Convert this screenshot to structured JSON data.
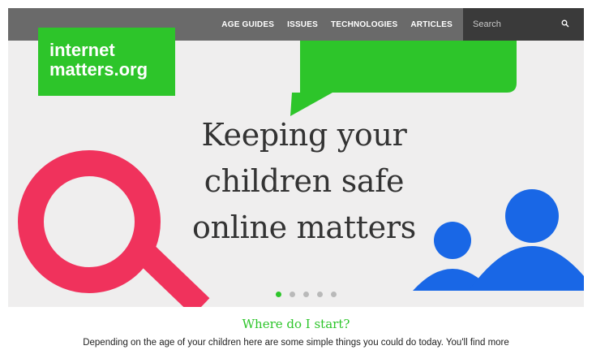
{
  "nav": {
    "items": [
      "AGE GUIDES",
      "ISSUES",
      "TECHNOLOGIES",
      "ARTICLES"
    ],
    "search_placeholder": "Search"
  },
  "logo": {
    "line1": "internet",
    "line2": "matters.org"
  },
  "hero": {
    "headline_lines": [
      "Keeping your",
      "children safe",
      "online matters"
    ],
    "carousel": {
      "slide_count": 5,
      "active_index": 0
    }
  },
  "intro": {
    "title": "Where do I start?",
    "text": "Depending on the age of your children here are some simple things you could do today. You'll find more"
  },
  "colors": {
    "brand_green": "#2dc52a",
    "nav_gray": "#6a6a6a",
    "search_dark": "#3a3a3a",
    "magnifier_pink": "#f0325c",
    "people_blue": "#1967e6"
  },
  "icons": {
    "search": "search-icon",
    "magnifier": "magnifying-glass-icon",
    "people": "people-icon",
    "speech_bubble": "speech-bubble-icon"
  }
}
